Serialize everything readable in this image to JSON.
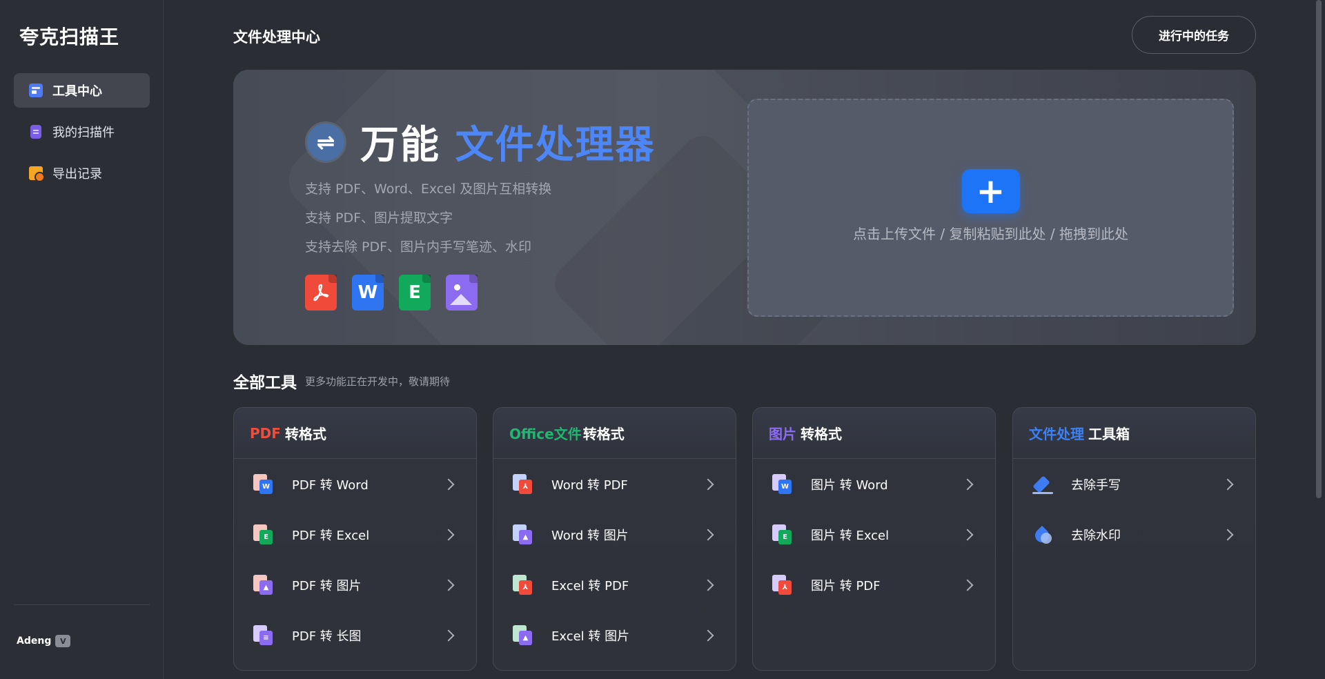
{
  "app": {
    "title": "夸克扫描王"
  },
  "sidebar": {
    "items": [
      {
        "label": "工具中心",
        "icon": "toolbox-icon",
        "active": true
      },
      {
        "label": "我的扫描件",
        "icon": "document-icon",
        "active": false
      },
      {
        "label": "导出记录",
        "icon": "folder-clock-icon",
        "active": false
      }
    ],
    "user": {
      "name": "Adeng",
      "badge": "V"
    }
  },
  "header": {
    "title": "文件处理中心",
    "tasks_button": "进行中的任务"
  },
  "hero": {
    "icon": "⇌",
    "title_plain": "万能",
    "title_highlight": "文件处理器",
    "lines": [
      "支持 PDF、Word、Excel 及图片互相转换",
      "支持 PDF、图片提取文字",
      "支持去除 PDF、图片内手写笔迹、水印"
    ],
    "format_icons": [
      "pdf-icon",
      "word-icon",
      "excel-icon",
      "image-icon"
    ],
    "word_letter": "W",
    "excel_letter": "E",
    "upload": {
      "button": "+",
      "hint": "点击上传文件 / 复制粘贴到此处 / 拖拽到此处"
    }
  },
  "tools_section": {
    "title": "全部工具",
    "subtitle": "更多功能正在开发中，敬请期待"
  },
  "cards": [
    {
      "head_colored": "PDF",
      "head_rest": "转格式",
      "tools": [
        "PDF 转 Word",
        "PDF 转 Excel",
        "PDF 转 图片",
        "PDF 转 长图"
      ]
    },
    {
      "head_colored": "Office文件",
      "head_rest": "转格式",
      "tools": [
        "Word 转 PDF",
        "Word 转 图片",
        "Excel 转 PDF",
        "Excel 转 图片"
      ]
    },
    {
      "head_colored": "图片",
      "head_rest": "转格式",
      "tools": [
        "图片 转 Word",
        "图片 转 Excel",
        "图片 转 PDF"
      ]
    },
    {
      "head_colored": "文件处理",
      "head_rest": "工具箱",
      "tools": [
        "去除手写",
        "去除水印"
      ]
    }
  ],
  "colors": {
    "accent": "#4d86f7",
    "pdf": "#ef4a3a",
    "word": "#2f74f0",
    "excel": "#12a95b",
    "image": "#8b6cf0",
    "upload_button": "#1e74f6"
  }
}
